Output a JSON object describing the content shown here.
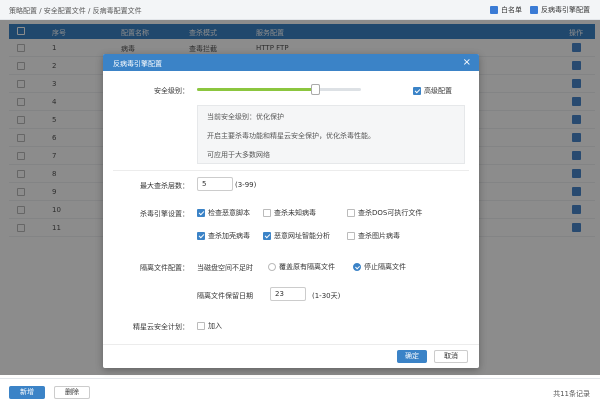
{
  "breadcrumb": "策略配置 / 安全配置文件 / 反病毒配置文件",
  "toolbar": {
    "whitelist": "白名单",
    "engine_config": "反病毒引擎配置"
  },
  "table": {
    "headers": [
      "序号",
      "配置名称",
      "查杀模式",
      "服务配置",
      "操作"
    ],
    "rows": [
      {
        "num": "1",
        "name": "病毒",
        "mode": "查毒拦截",
        "service": "HTTP  FTP"
      },
      {
        "num": "2"
      },
      {
        "num": "3"
      },
      {
        "num": "4"
      },
      {
        "num": "5"
      },
      {
        "num": "6"
      },
      {
        "num": "7"
      },
      {
        "num": "8"
      },
      {
        "num": "9"
      },
      {
        "num": "10"
      },
      {
        "num": "11"
      }
    ]
  },
  "footer": {
    "new_button": "新增",
    "delete_button": "删除",
    "total": "共11条记录"
  },
  "modal": {
    "title": "反病毒引擎配置",
    "security_level_label": "安全级别：",
    "security_level_value": 0.72,
    "advanced_config": "高级配置",
    "info_lines": [
      "当前安全级别：优化保护",
      "开启主要杀毒功能和精星云安全保护，优化杀毒性能。",
      "可应用于大多数网络"
    ],
    "max_layers_label": "最大查杀层数：",
    "max_layers_value": "5",
    "max_layers_hint": "(3-99)",
    "engine_settings_label": "杀毒引擎设置：",
    "engine_options": [
      {
        "label": "检查恶意脚本",
        "checked": true
      },
      {
        "label": "查杀未知病毒",
        "checked": false
      },
      {
        "label": "查杀DOS可执行文件",
        "checked": false
      },
      {
        "label": "查杀加壳病毒",
        "checked": true
      },
      {
        "label": "恶意网址智能分析",
        "checked": true
      },
      {
        "label": "查杀图片病毒",
        "checked": false
      }
    ],
    "quarantine_label": "隔离文件配置：",
    "quarantine_when": "当磁盘空间不足时",
    "quarantine_options": [
      {
        "label": "覆盖原有隔离文件",
        "selected": false
      },
      {
        "label": "停止隔离文件",
        "selected": true
      }
    ],
    "retention_label": "隔离文件保留日期",
    "retention_value": "23",
    "retention_hint": "(1-30天)",
    "cloud_plan_label": "精星云安全计划：",
    "cloud_join": "加入",
    "ok_button": "确定",
    "cancel_button": "取消"
  }
}
